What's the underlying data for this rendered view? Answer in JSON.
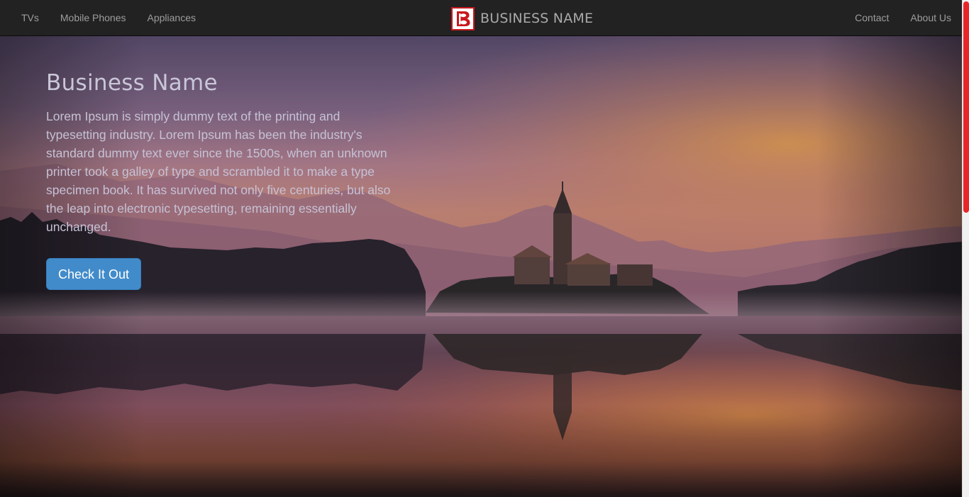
{
  "navbar": {
    "left_links": [
      {
        "label": "TVs"
      },
      {
        "label": "Mobile Phones"
      },
      {
        "label": "Appliances"
      }
    ],
    "brand": {
      "logo_icon": "letter-b-logo-icon",
      "name": "BUSINESS NAME",
      "logo_border_color": "#c9171d"
    },
    "right_links": [
      {
        "label": "Contact"
      },
      {
        "label": "About Us"
      }
    ]
  },
  "hero": {
    "title": "Business Name",
    "text": "Lorem Ipsum is simply dummy text of the printing and typesetting industry. Lorem Ipsum has been the industry's standard dummy text ever since the 1500s, when an unknown printer took a galley of type and scrambled it to make a type specimen book. It has survived not only five centuries, but also the leap into electronic typesetting, remaining essentially unchanged.",
    "button_label": "Check It Out",
    "button_color": "#428bca",
    "background": "lake-island-church-sunset-image"
  },
  "scrollbar": {
    "thumb_color": "#e8262a"
  }
}
